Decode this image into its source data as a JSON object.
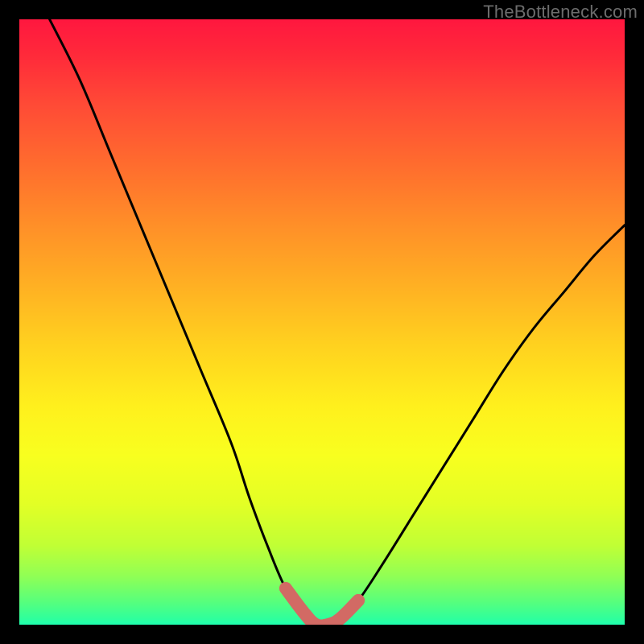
{
  "watermark": "TheBottleneck.com",
  "chart_data": {
    "type": "line",
    "title": "",
    "xlabel": "",
    "ylabel": "",
    "xlim": [
      0,
      100
    ],
    "ylim": [
      0,
      100
    ],
    "series": [
      {
        "name": "bottleneck-curve",
        "x": [
          5,
          10,
          15,
          20,
          25,
          30,
          35,
          38,
          41,
          44,
          47,
          49,
          51,
          53,
          56,
          60,
          65,
          70,
          75,
          80,
          85,
          90,
          95,
          100
        ],
        "values": [
          100,
          90,
          78,
          66,
          54,
          42,
          30,
          21,
          13,
          6,
          2,
          0,
          0,
          1,
          4,
          10,
          18,
          26,
          34,
          42,
          49,
          55,
          61,
          66
        ]
      }
    ],
    "highlight": {
      "name": "trough-band",
      "x": [
        44,
        47,
        49,
        51,
        53,
        56
      ],
      "values": [
        6,
        2,
        0,
        0,
        1,
        4
      ],
      "color": "#d26a64"
    },
    "background_gradient": {
      "top": "#ff173f",
      "bottom": "#1effb0"
    }
  }
}
